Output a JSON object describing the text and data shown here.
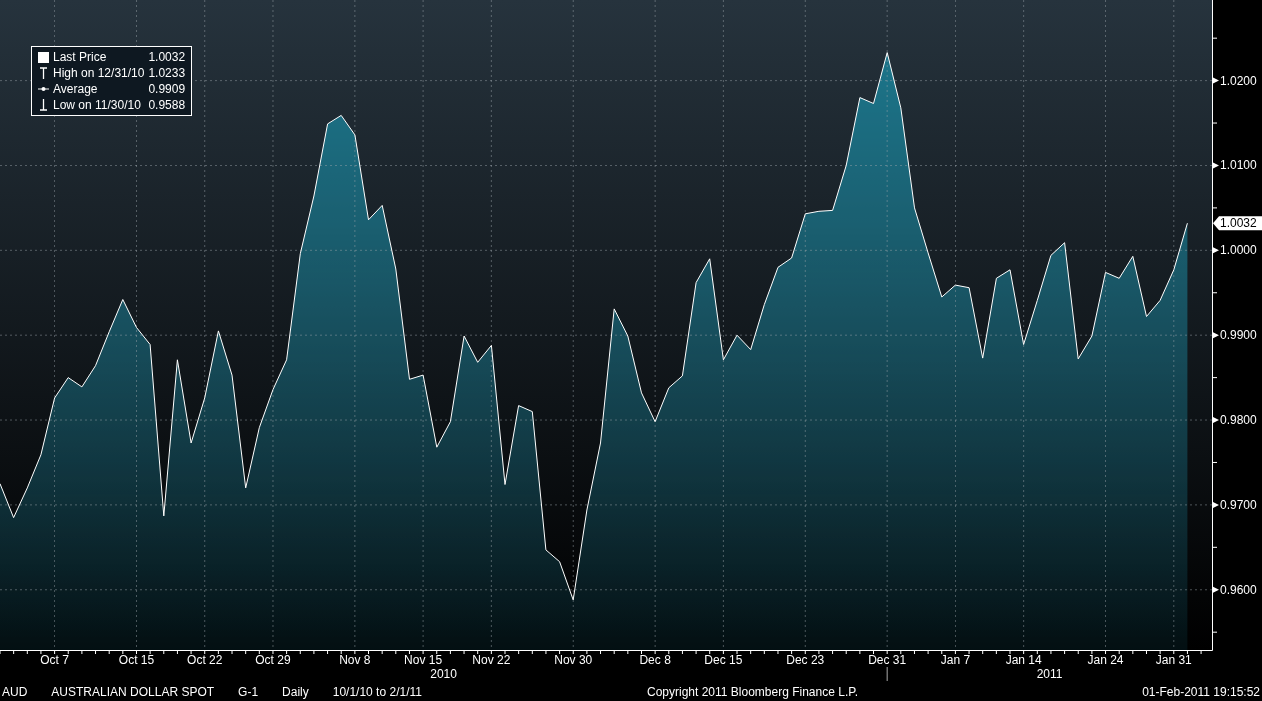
{
  "legend": [
    {
      "kind": "last",
      "label": "Last Price",
      "value": "1.0032"
    },
    {
      "kind": "high",
      "label": "High on 12/31/10",
      "value": "1.0233"
    },
    {
      "kind": "average",
      "label": "Average",
      "value": "0.9909"
    },
    {
      "kind": "low",
      "label": "Low on 11/30/10",
      "value": "0.9588"
    }
  ],
  "chart_data": {
    "type": "area",
    "grid": true,
    "ylim": [
      0.9529,
      1.0295
    ],
    "categories": [
      null,
      null,
      null,
      null,
      "Oct 7",
      null,
      null,
      null,
      null,
      null,
      "Oct 15",
      null,
      null,
      null,
      null,
      "Oct 22",
      null,
      null,
      null,
      null,
      "Oct 29",
      null,
      null,
      null,
      null,
      null,
      "Nov 8",
      null,
      null,
      null,
      null,
      "Nov 15",
      null,
      null,
      null,
      null,
      "Nov 22",
      null,
      null,
      null,
      null,
      null,
      "Nov 30",
      null,
      null,
      null,
      null,
      null,
      "Dec 8",
      null,
      null,
      null,
      null,
      "Dec 15",
      null,
      null,
      null,
      null,
      null,
      "Dec 23",
      null,
      null,
      null,
      null,
      null,
      "Dec 31",
      null,
      null,
      null,
      null,
      "Jan 7",
      null,
      null,
      null,
      null,
      "Jan 14",
      null,
      null,
      null,
      null,
      null,
      "Jan 24",
      null,
      null,
      null,
      null,
      "Jan 31",
      null
    ],
    "yticks": [
      {
        "value": 0.96,
        "label": "0.9600"
      },
      {
        "value": 0.97,
        "label": "0.9700"
      },
      {
        "value": 0.98,
        "label": "0.9800"
      },
      {
        "value": 0.99,
        "label": "0.9900"
      },
      {
        "value": 1.0,
        "label": "1.0000"
      },
      {
        "value": 1.01,
        "label": "1.0100"
      },
      {
        "value": 1.02,
        "label": "1.0200"
      }
    ],
    "annotations": [
      "2010",
      "2011"
    ],
    "series": [
      {
        "color": "#1b7a90",
        "values": [
          0.9725,
          0.9685,
          0.972,
          0.9759,
          0.9826,
          0.985,
          0.9839,
          0.9864,
          0.9904,
          0.9942,
          0.9909,
          0.9889,
          0.9687,
          0.9871,
          0.9773,
          0.9826,
          0.9905,
          0.9853,
          0.972,
          0.9791,
          0.9836,
          0.9871,
          0.9996,
          1.0064,
          1.0149,
          1.0159,
          1.0136,
          1.0036,
          1.0053,
          0.9978,
          0.9848,
          0.9853,
          0.9768,
          0.9798,
          0.9899,
          0.9868,
          0.9888,
          0.9724,
          0.9817,
          0.981,
          0.9647,
          0.9633,
          0.9588,
          0.9694,
          0.9773,
          0.9931,
          0.9899,
          0.9832,
          0.9798,
          0.9838,
          0.9852,
          0.9962,
          0.999,
          0.9871,
          0.99,
          0.9883,
          0.9936,
          0.998,
          0.9991,
          1.0043,
          1.0046,
          1.0047,
          1.01,
          1.018,
          1.0173,
          1.0233,
          1.0168,
          1.005,
          0.9997,
          0.9945,
          0.9959,
          0.9956,
          0.9873,
          0.9967,
          0.9977,
          0.9889,
          0.9941,
          0.9994,
          1.0009,
          0.9872,
          0.9899,
          0.9974,
          0.9967,
          0.9993,
          0.9922,
          0.9941,
          0.9977,
          1.0032
        ]
      }
    ]
  },
  "last_price_tag": "1.0032",
  "footer": {
    "security": [
      "AUD",
      "AUSTRALIAN DOLLAR SPOT",
      "G-1",
      "Daily",
      "10/1/10 to 2/1/11"
    ],
    "copyright": "Copyright 2011 Bloomberg Finance L.P.",
    "timestamp": "01-Feb-2011 19:15:52"
  }
}
